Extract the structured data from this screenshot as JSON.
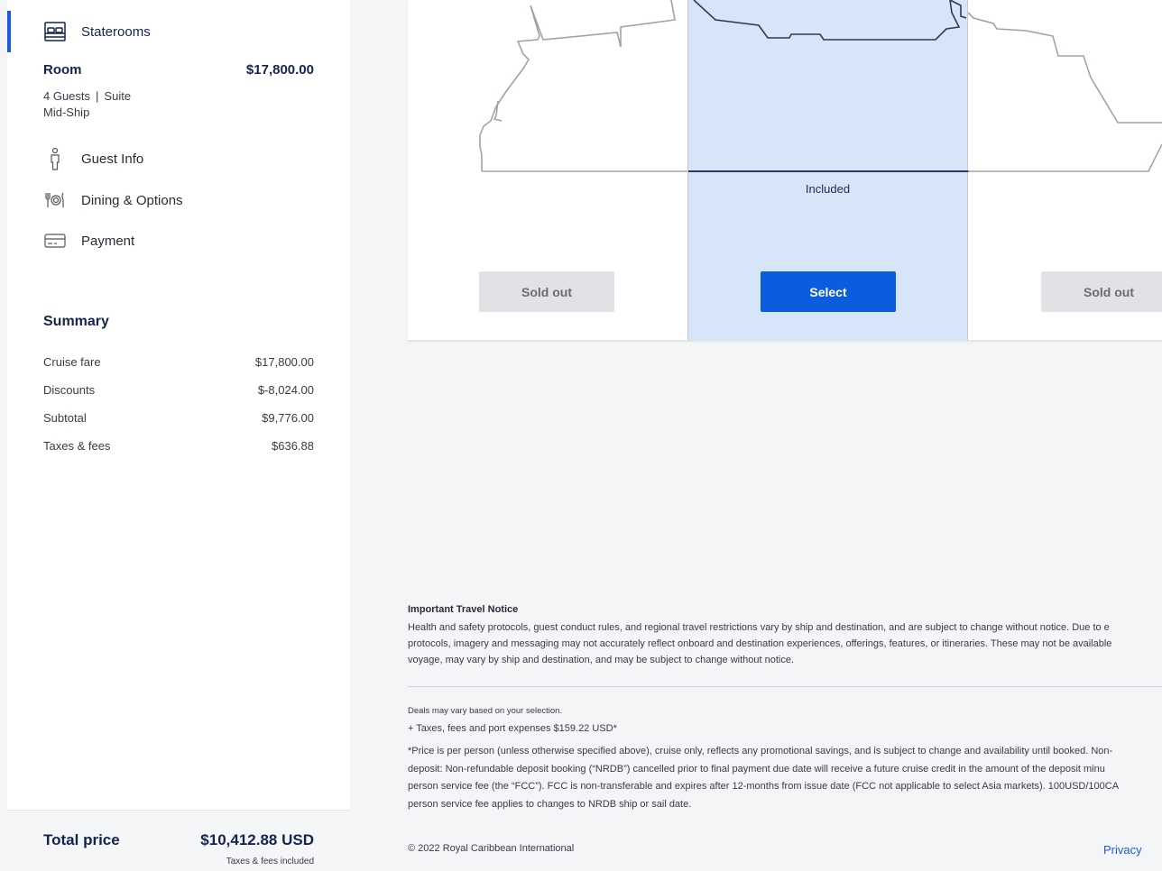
{
  "sidebar": {
    "nav": {
      "staterooms": "Staterooms",
      "guest_info": "Guest Info",
      "dining": "Dining & Options",
      "payment": "Payment"
    },
    "room": {
      "title": "Room",
      "price": "$17,800.00",
      "guests": "4 Guests",
      "separator": "|",
      "type": "Suite",
      "location": "Mid-Ship"
    },
    "summary": {
      "title": "Summary",
      "rows": [
        {
          "label": "Cruise fare",
          "value": "$17,800.00"
        },
        {
          "label": "Discounts",
          "value": "$-8,024.00"
        },
        {
          "label": "Subtotal",
          "value": "$9,776.00"
        },
        {
          "label": "Taxes & fees",
          "value": "$636.88"
        }
      ]
    },
    "total": {
      "label": "Total price",
      "value": "$10,412.88 USD",
      "note": "Taxes & fees included"
    }
  },
  "cards": {
    "col1_button": "Sold out",
    "col2_included": "Included",
    "col2_button": "Select",
    "col3_button": "Sold out"
  },
  "footer": {
    "notice_title": "Important Travel Notice",
    "notice_lines": [
      "Health and safety protocols, guest conduct rules, and regional travel restrictions vary by ship and destination, and are subject to change without notice. Due to e",
      "protocols, imagery and messaging may not accurately reflect onboard and destination experiences, offerings, features, or itineraries. These may not be available",
      "voyage, may vary by ship and destination, and may be subject to change without notice."
    ],
    "deals": "Deals may vary based on your selection.",
    "taxes": "+ Taxes, fees and port expenses $159.22 USD*",
    "price_lines": [
      "*Price is per person (unless otherwise specified above), cruise only, reflects any promotional savings, and is subject to change and availability until booked. Non-",
      "deposit: Non-refundable deposit booking (“NRDB”) cancelled prior to final payment due date will receive a future cruise credit in the amount of the deposit minu",
      "person service fee (the “FCC”). FCC is non-transferable and expires after 12-months from issue date (FCC not applicable to select Asia markets). 100USD/100CA",
      "person service fee applies to changes to NRDB ship or sail date."
    ],
    "copyright": "© 2022 Royal Caribbean International",
    "privacy": "Privacy"
  },
  "colors": {
    "accent": "#0b5ddd",
    "navy": "#15244d",
    "selected_bg": "#d6e6f8"
  },
  "icons": [
    "bed-icon",
    "person-icon",
    "dining-icon",
    "credit-card-icon"
  ]
}
